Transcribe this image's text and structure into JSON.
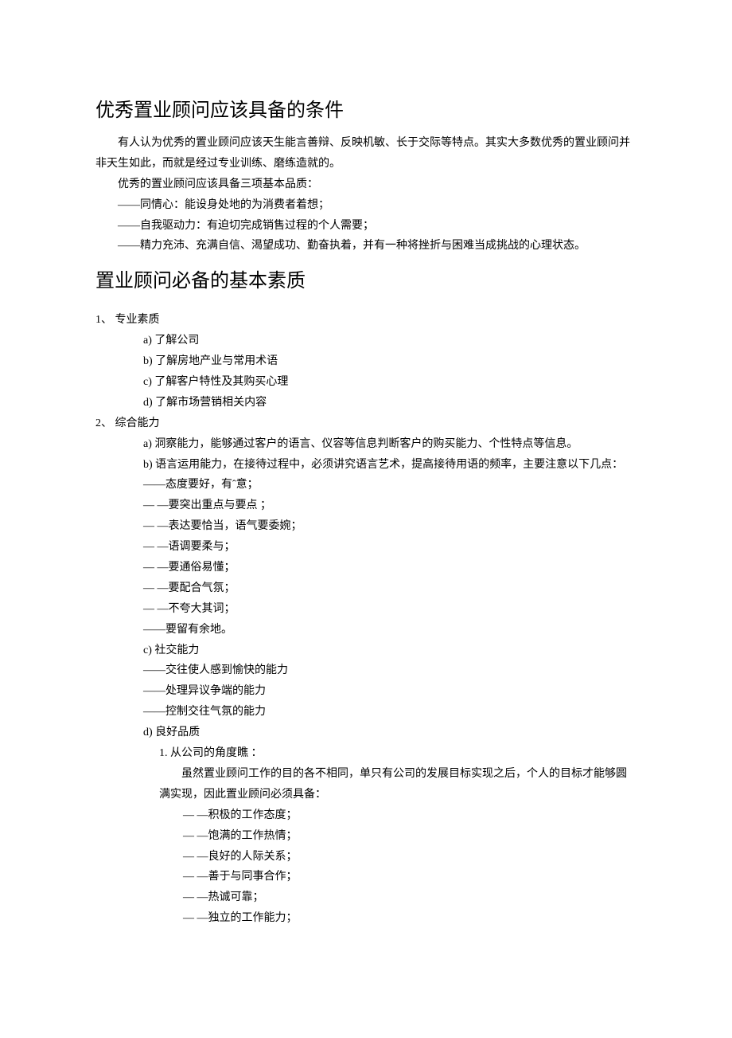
{
  "h1": "优秀置业顾问应该具备的条件",
  "p1": "有人认为优秀的置业顾问应该天生能言善辩、反映机敏、长于交际等特点。其实大多数优秀的置业顾问并非天生如此，而就是经过专业训练、磨练造就的。",
  "p2": "优秀的置业顾问应该具备三项基本品质：",
  "p3": "——同情心：能设身处地的为消费者着想；",
  "p4": "——自我驱动力：有迫切完成销售过程的个人需要；",
  "p5": "——精力充沛、充满自信、渴望成功、勤奋执着，并有一种将挫折与困难当成挑战的心理状态。",
  "h2": "置业顾问必备的基本素质",
  "n1": "1、  专业素质",
  "n1a": "a)    了解公司",
  "n1b": "b)    了解房地产业与常用术语",
  "n1c": "c)    了解客户特性及其购买心理",
  "n1d": "d)    了解市场营销相关内容",
  "n2": "2、  综合能力",
  "n2a": "a)    洞察能力，能够通过客户的语言、仪容等信息判断客户的购买能力、个性特点等信息。",
  "n2b": "b)    语言运用能力，在接待过程中，必须讲究语言艺术，提高接待用语的频率，主要注意以下几点：",
  "d1": "——态度要好，有ˆ意；",
  "d2": "—    —要突出重点与要点 ；",
  "d3": "—                  —表达要恰当，语气要委婉；",
  "d4": "—                  —语调要柔与；",
  "d5": "—                  —要通俗易懂；",
  "d6": "—                  —要配合气氛；",
  "d7": "—                  —不夸大其词；",
  "d8": "——要留有余地。",
  "n2c": "c)    社交能力",
  "s1": "——交往使人感到愉快的能力",
  "s2": "——处理异议争端的能力",
  "s3": "——控制交往气氛的能力",
  "n2d": "d)    良好品质",
  "q1": "1.        从公司的角度瞧 ：",
  "qp": "虽然置业顾问工作的目的各不相同，单只有公司的发展目标实现之后，个人的目标才能够圆满实现，因此置业顾问必须具备：",
  "qd1": "—                            —积极的工作态度；",
  "qd2": "—                            —饱满的工作热情；",
  "qd3": "—                            —良好的人际关系；",
  "qd4": "—                            —善于与同事合作；",
  "qd5": "—                  —热诚可靠；",
  "qd6": "—                                 —独立的工作能力；"
}
